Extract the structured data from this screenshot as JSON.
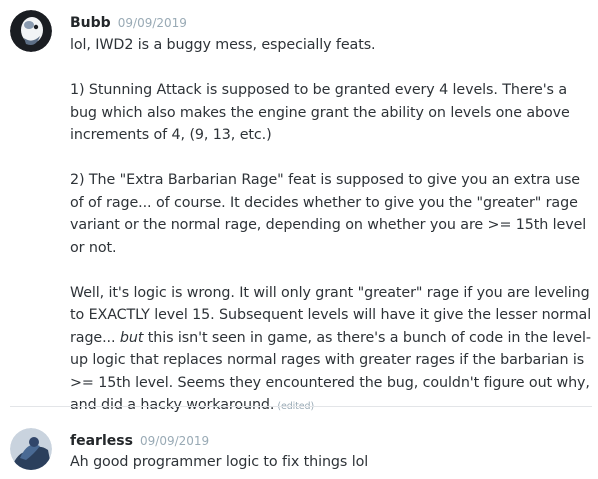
{
  "messages": [
    {
      "author": "Bubb",
      "timestamp": "09/09/2019",
      "avatar_icon": "bubb-avatar-icon",
      "paragraphs": [
        "lol, IWD2 is a buggy mess, especially feats.",
        "1) Stunning Attack is supposed to be granted every 4 levels. There's a bug which also makes the engine grant the ability on levels one above increments of 4, (9, 13, etc.)",
        "2) The \"Extra Barbarian Rage\" feat is supposed to give you an extra use of of rage... of course. It decides whether to give you the \"greater\" rage variant or the normal rage, depending on whether you are >= 15th level or not.",
        "Well, it's logic is wrong. It will only grant \"greater\" rage if you are leveling to EXACTLY level 15. Subsequent levels will have it give the lesser normal rage..."
      ],
      "last_emph": "but",
      "last_rest": " this isn't seen in game, as there's a bunch of code in the level-up logic that replaces normal rages with greater rages if the barbarian is >= 15th level. Seems they encountered the bug, couldn't figure out why, and did a hacky workaround.",
      "edited_label": "(edited)"
    },
    {
      "author": "fearless",
      "timestamp": "09/09/2019",
      "avatar_icon": "fearless-avatar-icon",
      "text": "Ah good programmer logic to fix things lol"
    }
  ]
}
